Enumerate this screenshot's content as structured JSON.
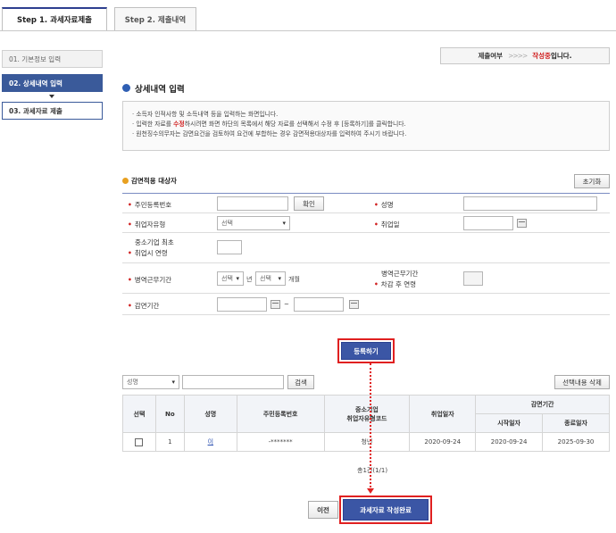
{
  "tabs": [
    {
      "label": "Step 1. 과세자료제출"
    },
    {
      "label": "Step 2. 제출내역"
    }
  ],
  "steps": [
    {
      "label": "01. 기본정보 입력"
    },
    {
      "label": "02. 상세내역 입력"
    },
    {
      "label": "03. 과세자료 제출"
    }
  ],
  "status": {
    "label": "제출여부",
    "arrows": ">>>>",
    "value": "작성중",
    "suffix": "입니다."
  },
  "section_title": "상세내역 입력",
  "notice": {
    "line1": "· 소득자 인적사항 및 소득내역 등을 입력하는 화면입니다.",
    "line2_pre": "· 입력한 자료를 ",
    "line2_red": "수정",
    "line2_post": "하시려면 화면 하단의 목록에서 해당 자료를 선택해서 수정 후 [등록하기]를 클릭합니다.",
    "line3": "· 원천징수의무자는 감면요건을 검토하여 요건에 부합하는 경우 감면적용대상자를 입력하여 주시기 바랍니다."
  },
  "subsection": {
    "title": "감면적용 대상자",
    "reset_label": "초기화"
  },
  "form": {
    "resident_no_label": "주민등록번호",
    "verify_label": "확인",
    "name_label": "성명",
    "type_label": "취업자유형",
    "type_value": "선택",
    "hire_date_label": "취업일",
    "age_label_1": "중소기업 최초",
    "age_label_2": "취업시 연령",
    "military_label": "병역근무기간",
    "year_select": "선택",
    "year_unit": "년",
    "month_select": "선택",
    "month_unit": "개월",
    "military_age_label_1": "병역근무기간",
    "military_age_label_2": "차감 후 연령",
    "reduction_label": "감면기간",
    "tilde": "~"
  },
  "register_label": "등록하기",
  "list": {
    "search_select": "성명",
    "search_label": "검색",
    "delete_label": "선택내용 삭제",
    "headers": {
      "select": "선택",
      "no": "No",
      "name": "성명",
      "rrn": "주민등록번호",
      "code_1": "중소기업",
      "code_2": "취업자유형코드",
      "hire": "취업일자",
      "period": "감면기간",
      "start": "시작일자",
      "end": "종료일자"
    },
    "rows": [
      {
        "no": "1",
        "name": "이",
        "rrn": "-*******",
        "code": "청년",
        "hire": "2020-09-24",
        "start": "2020-09-24",
        "end": "2025-09-30"
      }
    ],
    "total": "총1건(1/1)"
  },
  "footer": {
    "prev_label": "이전",
    "complete_label": "과세자료 작성완료"
  },
  "colors": {
    "accent": "#3b56a5",
    "highlight": "#e02020",
    "step_active": "#3a5a9a"
  }
}
